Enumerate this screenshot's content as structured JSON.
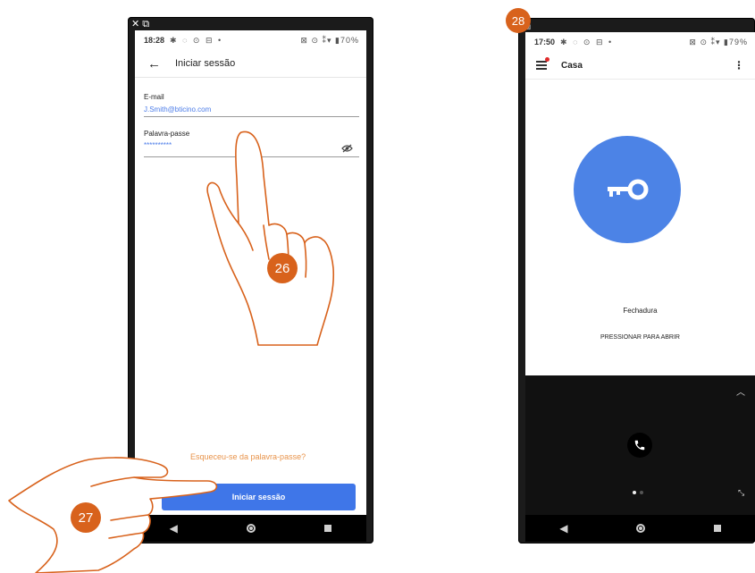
{
  "left_phone": {
    "window_controls": "✕ ⧉",
    "status": {
      "time": "18:28",
      "icons": "✱ ◌ ⊙ ⊟ •",
      "right": "⊠ ⊙ ⁑▾ ▮70%"
    },
    "header": {
      "title": "Iniciar sessão"
    },
    "email": {
      "label": "E-mail",
      "value": "J.Smith@bticino.com"
    },
    "password": {
      "label": "Palavra-passe",
      "value": "**********"
    },
    "forgot_link": "Esqueceu-se da palavra-passe?",
    "login_button": "Iniciar sessão"
  },
  "right_phone": {
    "window_controls": "⧉",
    "status": {
      "time": "17:50",
      "icons": "✱ ◌ ⊙ ⊟ •",
      "right": "⊠ ⊙ ⁑▾ ▮79%"
    },
    "header": {
      "title": "Casa"
    },
    "lock": {
      "name": "Fechadura",
      "action": "PRESSIONAR PARA ABRIR"
    }
  },
  "step_badges": {
    "tap_password": "26",
    "tap_login": "27",
    "result": "28"
  },
  "colors": {
    "accent_blue": "#3f76e8",
    "lock_blue": "#4c83e6",
    "link_orange": "#e8934a",
    "badge": "#d8621c"
  }
}
